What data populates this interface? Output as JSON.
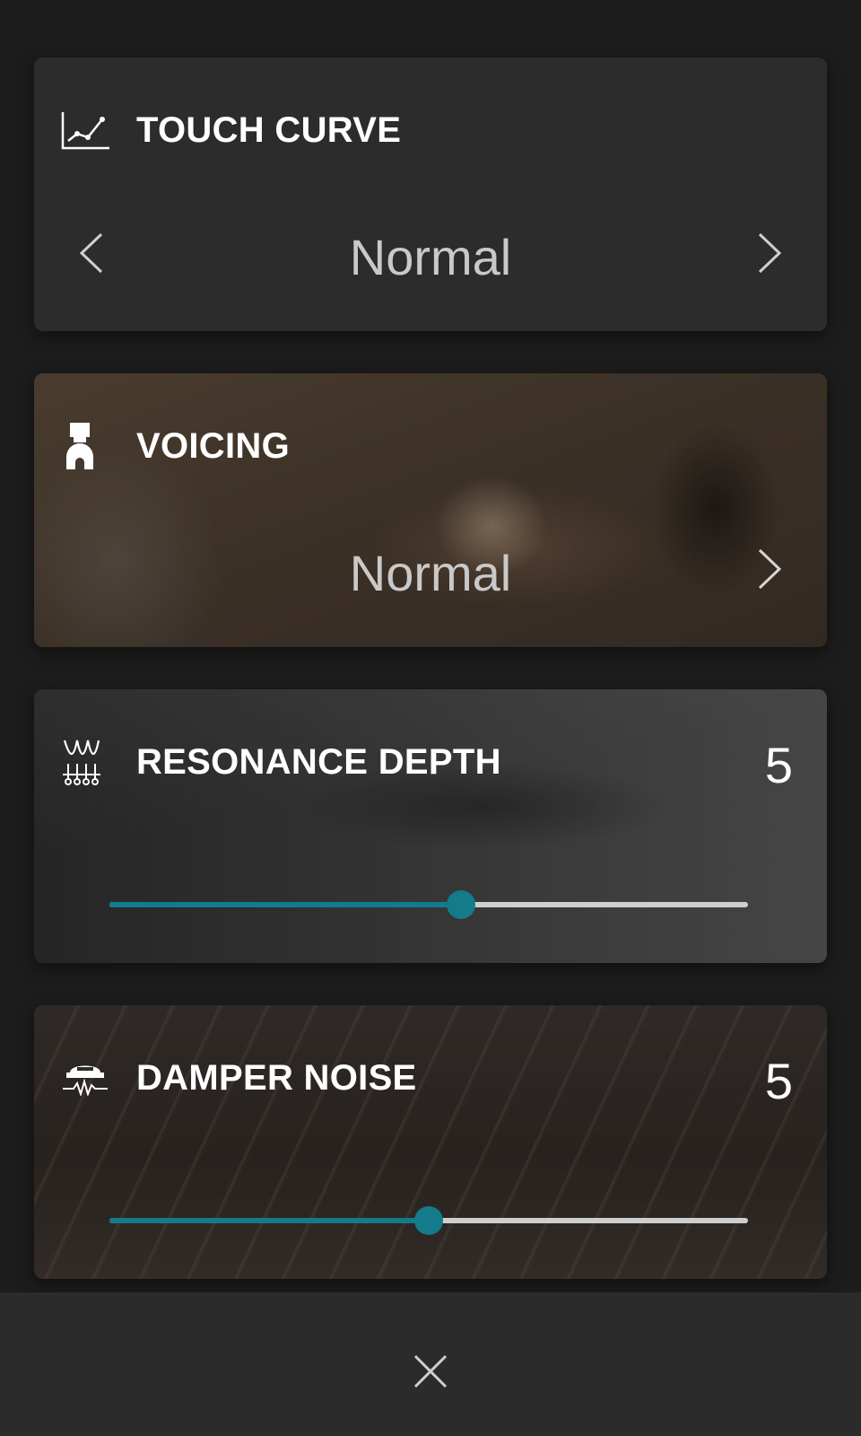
{
  "touch_curve": {
    "title": "TOUCH CURVE",
    "value": "Normal",
    "icon": "chart-line-icon"
  },
  "voicing": {
    "title": "VOICING",
    "value": "Normal",
    "icon": "hammer-felt-icon"
  },
  "resonance_depth": {
    "title": "RESONANCE DEPTH",
    "value": "5",
    "level_fraction": 0.55,
    "icon": "resonance-icon"
  },
  "damper_noise": {
    "title": "DAMPER NOISE",
    "value": "5",
    "level_fraction": 0.5,
    "icon": "damper-icon"
  },
  "colors": {
    "accent": "#137b8a",
    "card": "#2c2c2c",
    "background": "#1c1c1c"
  }
}
